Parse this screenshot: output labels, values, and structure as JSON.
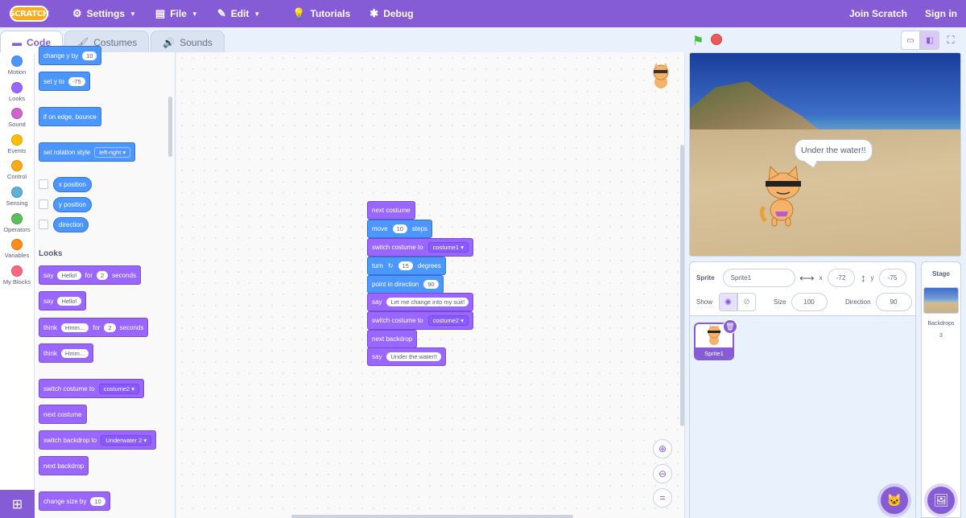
{
  "menubar": {
    "logo": "SCRATCH",
    "settings": "Settings",
    "file": "File",
    "edit": "Edit",
    "tutorials": "Tutorials",
    "debug": "Debug",
    "join": "Join Scratch",
    "signin": "Sign in"
  },
  "tabs": {
    "code": "Code",
    "costumes": "Costumes",
    "sounds": "Sounds"
  },
  "categories": [
    {
      "label": "Motion",
      "color": "#4c97ff"
    },
    {
      "label": "Looks",
      "color": "#9966ff"
    },
    {
      "label": "Sound",
      "color": "#cf63cf"
    },
    {
      "label": "Events",
      "color": "#ffbf00"
    },
    {
      "label": "Control",
      "color": "#ffab19"
    },
    {
      "label": "Sensing",
      "color": "#5cb1d6"
    },
    {
      "label": "Operators",
      "color": "#59c059"
    },
    {
      "label": "Variables",
      "color": "#ff8c1a"
    },
    {
      "label": "My Blocks",
      "color": "#ff6680"
    }
  ],
  "palette": {
    "change_y": {
      "label": "change y by",
      "value": "10"
    },
    "set_y": {
      "label": "set y to",
      "value": "-75"
    },
    "bounce": "if on edge, bounce",
    "rotation": {
      "label": "set rotation style",
      "value": "left-right"
    },
    "x_position": "x position",
    "y_position": "y position",
    "direction": "direction",
    "looks_heading": "Looks",
    "say_for": {
      "say": "say",
      "text": "Hello!",
      "for": "for",
      "secs": "2",
      "seconds": "seconds"
    },
    "say": {
      "say": "say",
      "text": "Hello!"
    },
    "think_for": {
      "think": "think",
      "text": "Hmm...",
      "for": "for",
      "secs": "2",
      "seconds": "seconds"
    },
    "think": {
      "think": "think",
      "text": "Hmm..."
    },
    "switch_costume": {
      "label": "switch costume to",
      "value": "costume2"
    },
    "next_costume": "next costume",
    "switch_backdrop": {
      "label": "switch backdrop to",
      "value": "Underwater 2"
    },
    "next_backdrop": "next backdrop",
    "change_size": {
      "label": "change size by",
      "value": "10"
    }
  },
  "script": {
    "b1": "next costume",
    "b2": {
      "move": "move",
      "steps_val": "10",
      "steps": "steps"
    },
    "b3": {
      "label": "switch costume to",
      "value": "costume1"
    },
    "b4": {
      "turn": "turn",
      "deg_val": "15",
      "degrees": "degrees"
    },
    "b5": {
      "label": "point in direction",
      "value": "90"
    },
    "b6": {
      "say": "say",
      "text": "Let me change into my suit!"
    },
    "b7": {
      "label": "switch costume to",
      "value": "costume2"
    },
    "b8": "next backdrop",
    "b9": {
      "say": "say",
      "text": "Under the water!!"
    }
  },
  "stage": {
    "bubble": "Under the water!!"
  },
  "sprite_info": {
    "sprite_label": "Sprite",
    "sprite_name": "Sprite1",
    "x_label": "x",
    "x_value": "-72",
    "y_label": "y",
    "y_value": "-75",
    "show_label": "Show",
    "size_label": "Size",
    "size_value": "100",
    "direction_label": "Direction",
    "direction_value": "90"
  },
  "sprite_list": [
    {
      "name": "Sprite1"
    }
  ],
  "stage_panel": {
    "title": "Stage",
    "backdrops_label": "Backdrops",
    "backdrops_count": "3"
  }
}
